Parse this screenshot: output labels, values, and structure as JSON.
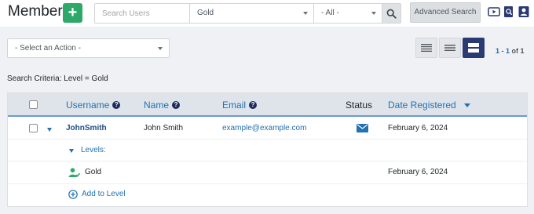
{
  "header": {
    "title": "Members",
    "add_label": "+",
    "search_placeholder": "Search Users",
    "level_filter": "Gold",
    "status_filter": "- All -",
    "advanced_search_label": "Advanced Search"
  },
  "toolbar": {
    "action_placeholder": "- Select an Action -",
    "pagination": {
      "start": "1",
      "separator": " - ",
      "end": "1",
      "of_label": " of ",
      "total": "1"
    }
  },
  "criteria": "Search Criteria: Level = Gold",
  "table": {
    "columns": {
      "username": "Username",
      "name": "Name",
      "email": "Email",
      "status": "Status",
      "date_registered": "Date Registered"
    },
    "row": {
      "username": "JohnSmith",
      "name": "John Smith",
      "email": "example@example.com",
      "date_registered": "February 6, 2024"
    },
    "levels_label": "Levels:",
    "level": {
      "name": "Gold",
      "date": "February 6, 2024"
    },
    "add_to_level": "Add to Level"
  },
  "icons": {
    "add": "plus-icon",
    "search": "magnifier-icon",
    "video": "video-icon",
    "search_doc": "search-document-icon",
    "user_card": "user-card-icon",
    "help": "question-circle-icon",
    "status": "envelope-icon",
    "level_member": "user-check-icon",
    "add_level": "plus-circle-icon",
    "view_compact": "list-compact-icon",
    "view_list": "list-icon",
    "view_expanded": "list-expanded-icon"
  },
  "colors": {
    "add_button": "#2ea868",
    "link": "#2271b1",
    "username": "#1d4e89",
    "active_view": "#2a3a73",
    "header_row": "#dfe4ea",
    "level_icon": "#2ea868"
  }
}
